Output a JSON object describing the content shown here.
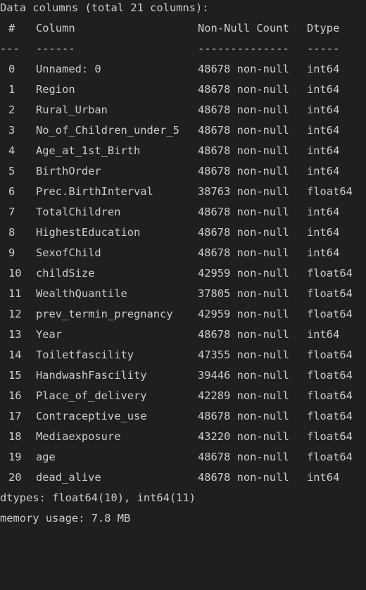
{
  "summary": {
    "header": "Data columns (total 21 columns):",
    "dtypes": "dtypes: float64(10), int64(11)",
    "memory": "memory usage: 7.8 MB"
  },
  "table": {
    "headers": {
      "index": "#",
      "column": "Column",
      "count": "Non-Null Count",
      "dtype": "Dtype"
    },
    "separators": {
      "index": "---",
      "column": "------",
      "count": "--------------",
      "dtype": "-----"
    },
    "rows": [
      {
        "index": "0",
        "column": "Unnamed: 0",
        "count": "48678 non-null",
        "dtype": "int64"
      },
      {
        "index": "1",
        "column": "Region",
        "count": "48678 non-null",
        "dtype": "int64"
      },
      {
        "index": "2",
        "column": "Rural_Urban",
        "count": "48678 non-null",
        "dtype": "int64"
      },
      {
        "index": "3",
        "column": "No_of_Children_under_5",
        "count": "48678 non-null",
        "dtype": "int64"
      },
      {
        "index": "4",
        "column": "Age_at_1st_Birth",
        "count": "48678 non-null",
        "dtype": "int64"
      },
      {
        "index": "5",
        "column": "BirthOrder",
        "count": "48678 non-null",
        "dtype": "int64"
      },
      {
        "index": "6",
        "column": "Prec.BirthInterval",
        "count": "38763 non-null",
        "dtype": "float64"
      },
      {
        "index": "7",
        "column": "TotalChildren",
        "count": "48678 non-null",
        "dtype": "int64"
      },
      {
        "index": "8",
        "column": "HighestEducation",
        "count": "48678 non-null",
        "dtype": "int64"
      },
      {
        "index": "9",
        "column": "SexofChild",
        "count": "48678 non-null",
        "dtype": "int64"
      },
      {
        "index": "10",
        "column": "childSize",
        "count": "42959 non-null",
        "dtype": "float64"
      },
      {
        "index": "11",
        "column": "WealthQuantile",
        "count": "37805 non-null",
        "dtype": "float64"
      },
      {
        "index": "12",
        "column": "prev_termin_pregnancy",
        "count": "42959 non-null",
        "dtype": "float64"
      },
      {
        "index": "13",
        "column": "Year",
        "count": "48678 non-null",
        "dtype": "int64"
      },
      {
        "index": "14",
        "column": "Toiletfascility",
        "count": "47355 non-null",
        "dtype": "float64"
      },
      {
        "index": "15",
        "column": "HandwashFascility",
        "count": "39446 non-null",
        "dtype": "float64"
      },
      {
        "index": "16",
        "column": "Place_of_delivery",
        "count": "42289 non-null",
        "dtype": "float64"
      },
      {
        "index": "17",
        "column": "Contraceptive_use",
        "count": "48678 non-null",
        "dtype": "float64"
      },
      {
        "index": "18",
        "column": "Mediaexposure",
        "count": "43220 non-null",
        "dtype": "float64"
      },
      {
        "index": "19",
        "column": "age",
        "count": "48678 non-null",
        "dtype": "float64"
      },
      {
        "index": "20",
        "column": "dead_alive",
        "count": "48678 non-null",
        "dtype": "int64"
      }
    ]
  }
}
